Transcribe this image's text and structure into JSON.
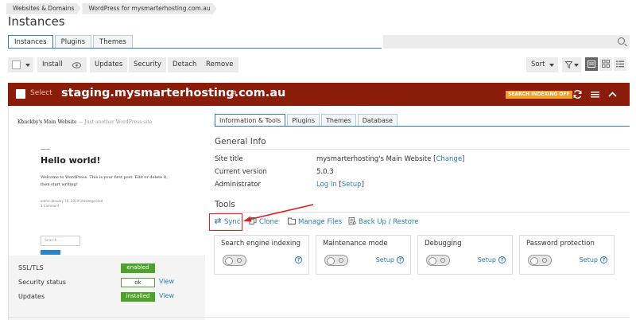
{
  "breadcrumb": [
    "Websites & Domains",
    "WordPress for mysmarterhosting.com.au"
  ],
  "page_title": "Instances",
  "tabs": [
    {
      "label": "Instances",
      "active": true
    },
    {
      "label": "Plugins",
      "active": false
    },
    {
      "label": "Themes",
      "active": false
    }
  ],
  "search": {
    "placeholder": "",
    "icon": "search-icon"
  },
  "toolbar": {
    "install": "Install",
    "updates": "Updates",
    "security": "Security",
    "detach": "Detach",
    "remove": "Remove",
    "sort": "Sort"
  },
  "instance": {
    "select_label": "Select",
    "domain": "staging.mysmarterhosting.com.au",
    "badge": "SEARCH INDEXING OFF"
  },
  "preview": {
    "site_name": "Kbuckby's Main Website",
    "tagline": "— Just another WordPress site",
    "post_title": "Hello world!",
    "post_body": "Welcome to WordPress. This is your first post. Edit or delete it, then start writing!",
    "meta_author": "admin",
    "meta_date": "January 16, 2019",
    "meta_category": "Uncategorized",
    "meta_comments": "1 Comment",
    "search_placeholder": "Search ..."
  },
  "status": {
    "ssl_label": "SSL/TLS",
    "ssl_value": "enabled",
    "security_label": "Security status",
    "security_value": "ok",
    "security_link": "View",
    "updates_label": "Updates",
    "updates_value": "installed",
    "updates_link": "View"
  },
  "inner_tabs": [
    {
      "label": "Information & Tools",
      "active": true
    },
    {
      "label": "Plugins",
      "active": false
    },
    {
      "label": "Themes",
      "active": false
    },
    {
      "label": "Database",
      "active": false
    }
  ],
  "general_info": {
    "heading": "General Info",
    "site_title_label": "Site title",
    "site_title_value": "mysmarterhosting's Main Website",
    "change_link": "Change",
    "version_label": "Current version",
    "version_value": "5.0.3",
    "admin_label": "Administrator",
    "login_link": "Log In",
    "setup_link": "Setup"
  },
  "tools": {
    "heading": "Tools",
    "sync": "Sync",
    "clone": "Clone",
    "manage_files": "Manage Files",
    "backup": "Back Up / Restore"
  },
  "cards": [
    {
      "title": "Search engine indexing",
      "setup": ""
    },
    {
      "title": "Maintenance mode",
      "setup": "Setup"
    },
    {
      "title": "Debugging",
      "setup": "Setup"
    },
    {
      "title": "Password protection",
      "setup": "Setup"
    }
  ],
  "colors": {
    "banner": "#8b1c0a",
    "accent": "#2b7fb8",
    "badge": "#f0a12d",
    "green": "#4ca32a",
    "highlight": "#e21b1b"
  }
}
